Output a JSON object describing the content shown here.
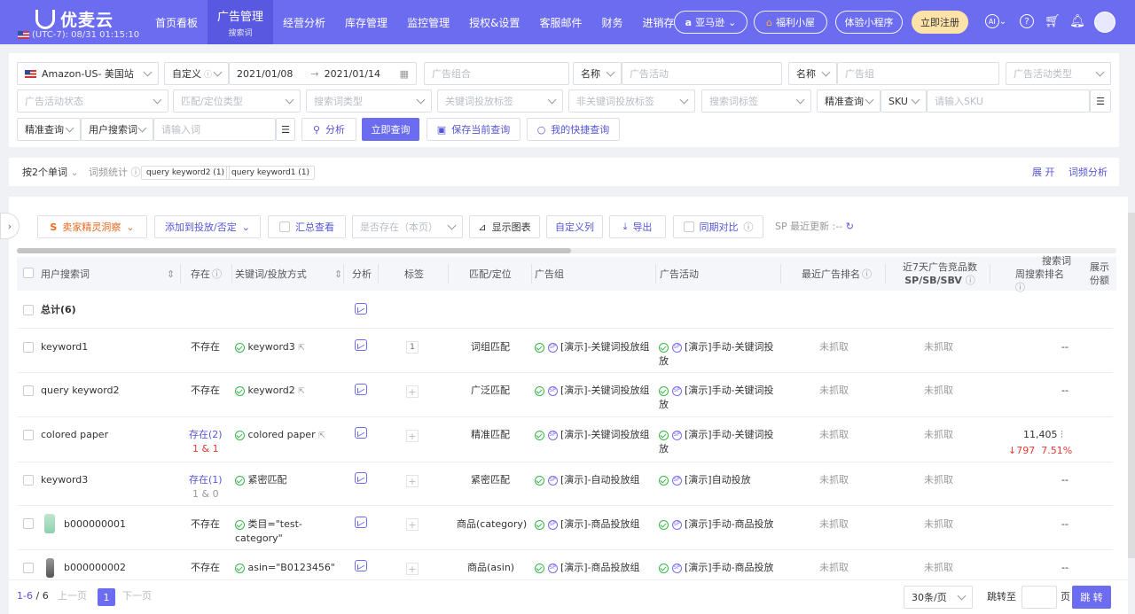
{
  "app": {
    "name": "优麦云",
    "timezone": "(UTC-7): 08/31 01:15:10"
  },
  "nav": [
    {
      "label": "首页看板"
    },
    {
      "label": "广告管理",
      "sub": "搜索词"
    },
    {
      "label": "经营分析"
    },
    {
      "label": "库存管理"
    },
    {
      "label": "监控管理"
    },
    {
      "label": "授权&设置"
    },
    {
      "label": "客服邮件"
    },
    {
      "label": "财务"
    },
    {
      "label": "进销存"
    }
  ],
  "topright": {
    "platform": "亚马逊",
    "welfare": "福利小屋",
    "miniapp": "体验小程序",
    "register": "立即注册",
    "ai": "AI"
  },
  "filters": {
    "site": "Amazon-US- 美国站",
    "date_mode": "自定义",
    "date_start": "2021/01/08",
    "date_arrow": "→",
    "date_end": "2021/01/14",
    "ad_portfolio_ph": "广告组合",
    "name1": "名称",
    "campaign_ph": "广告活动",
    "name2": "名称",
    "adgroup_ph": "广告组",
    "campaign_type_ph": "广告活动类型",
    "campaign_status_ph": "广告活动状态",
    "match_type_ph": "匹配/定位类型",
    "search_type_ph": "搜索词类型",
    "kw_tag_ph": "关键词投放标签",
    "nonkw_tag_ph": "非关键词投放标签",
    "search_tag_ph": "搜索词标签",
    "exact1": "精准查询",
    "sku_label": "SKU",
    "sku_ph": "请输入SKU",
    "exact2": "精准查询",
    "user_search_label": "用户搜索词",
    "word_ph": "请输入词",
    "analyze": "分析",
    "query": "立即查询",
    "save_query": "保存当前查询",
    "my_quick": "我的快捷查询"
  },
  "wordbar": {
    "group_by": "按2个单词",
    "freq": "词频统计",
    "tags": [
      "query keyword2 (1)",
      "query keyword1 (1)"
    ],
    "expand": "展 开",
    "analysis": "词频分析"
  },
  "toolbar": {
    "spirit": "卖家精灵洞察",
    "add": "添加到投放/否定",
    "summary": "汇总查看",
    "exist_ph": "是否存在（本页）",
    "chart": "显示图表",
    "custom_col": "自定义列",
    "export": "导出",
    "compare": "同期对比",
    "sp_update": "SP 最近更新 :--"
  },
  "columns": [
    "用户搜索词",
    "存在",
    "关键词/投放方式",
    "分析",
    "标签",
    "匹配/定位",
    "广告组",
    "广告活动",
    "最近广告排名",
    "近7天广告竞品数",
    "SP/SB/SBV",
    "搜索词",
    "周搜索排名",
    "展示",
    "份额"
  ],
  "total": "总计(6)",
  "rows": [
    {
      "term": "keyword1",
      "exist": "不存在",
      "exist_detail": "",
      "kw": "keyword3",
      "tag": "1",
      "match": "词组匹配",
      "adgroup": "[演示]-关键词投放组",
      "campaign": "[演示]手动-关键词投放",
      "rank": "未抓取",
      "comp": "未抓取",
      "search_rank": "--",
      "delta": "",
      "pct": ""
    },
    {
      "term": "query keyword2",
      "exist": "不存在",
      "exist_detail": "",
      "kw": "keyword2",
      "tag": "+",
      "match": "广泛匹配",
      "adgroup": "[演示]-关键词投放组",
      "campaign": "[演示]手动-关键词投放",
      "rank": "未抓取",
      "comp": "未抓取",
      "search_rank": "--",
      "delta": "",
      "pct": ""
    },
    {
      "term": "colored paper",
      "exist": "存在(2)",
      "exist_detail": "1 & 1",
      "kw": "colored paper",
      "tag": "+",
      "match": "精准匹配",
      "adgroup": "[演示]-关键词投放组",
      "campaign": "[演示]手动-关键词投放",
      "rank": "未抓取",
      "comp": "未抓取",
      "search_rank": "11,405",
      "delta": "↓797",
      "pct": "7.51%"
    },
    {
      "term": "keyword3",
      "exist": "存在(1)",
      "exist_detail": "1 & 0",
      "kw": "紧密匹配",
      "tag": "+",
      "match": "紧密匹配",
      "adgroup": "[演示]-自动投放组",
      "campaign": "[演示]自动投放",
      "rank": "未抓取",
      "comp": "未抓取",
      "search_rank": "--",
      "delta": "",
      "pct": ""
    },
    {
      "term": "b000000001",
      "exist": "不存在",
      "exist_detail": "",
      "kw": "类目=\"test-category\"",
      "tag": "+",
      "match": "商品(category)",
      "adgroup": "[演示]-商品投放组",
      "campaign": "[演示]手动-商品投放",
      "rank": "未抓取",
      "comp": "未抓取",
      "search_rank": "--",
      "delta": "",
      "pct": ""
    },
    {
      "term": "b000000002",
      "exist": "不存在",
      "exist_detail": "",
      "kw": "asin=\"B0123456\"",
      "tag": "+",
      "match": "商品(asin)",
      "adgroup": "[演示]-商品投放组",
      "campaign": "[演示]手动-商品投放",
      "rank": "未抓取",
      "comp": "未抓取",
      "search_rank": "--",
      "delta": "",
      "pct": ""
    }
  ],
  "pagination": {
    "range": "1-6",
    "sep": "/",
    "total": "6",
    "prev": "上一页",
    "page": "1",
    "next": "下一页",
    "per_page": "30条/页",
    "goto": "跳转至",
    "page_unit": "页",
    "go": "跳 转"
  }
}
